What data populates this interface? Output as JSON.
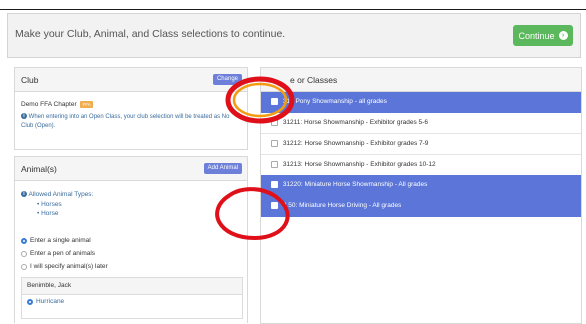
{
  "header": {
    "message": "Make your Club, Animal, and Class selections to continue.",
    "continue_label": "Continue"
  },
  "club": {
    "title": "Club",
    "change_label": "Change",
    "name": "Demo FFA Chapter",
    "badge": "FFA",
    "info": "When entering into an Open Class, your club selection will be treated as No Club (Open)."
  },
  "animals": {
    "title": "Animal(s)",
    "add_label": "Add Animal",
    "allowed_title": "Allowed Animal Types:",
    "types": [
      "Horses",
      "Horse"
    ],
    "options": [
      {
        "label": "Enter a single animal",
        "selected": true
      },
      {
        "label": "Enter a pen of animals",
        "selected": false
      },
      {
        "label": "I will specify animal(s) later",
        "selected": false
      }
    ],
    "owner": "Benimble, Jack",
    "animal_name": "Hurricane"
  },
  "classes": {
    "title": "e or Classes",
    "rows": [
      {
        "label": "312 Pony Showmanship - all grades",
        "selected": true
      },
      {
        "label": "31211: Horse Showmanship - Exhibitor grades 5-6",
        "selected": false
      },
      {
        "label": "31212: Horse Showmanship - Exhibitor grades 7-9",
        "selected": false
      },
      {
        "label": "31213: Horse Showmanship - Exhibitor grades 10-12",
        "selected": false
      },
      {
        "label": "31220: Miniature Horse Showmanship - All grades",
        "selected": true
      },
      {
        "label": "3 50: Miniature Horse Driving - All grades",
        "selected": true
      }
    ]
  },
  "colors": {
    "accent_green": "#5cb85c",
    "selection_blue": "#5b76d8",
    "annotation_red": "#e0101a",
    "annotation_orange": "#f39c12"
  }
}
